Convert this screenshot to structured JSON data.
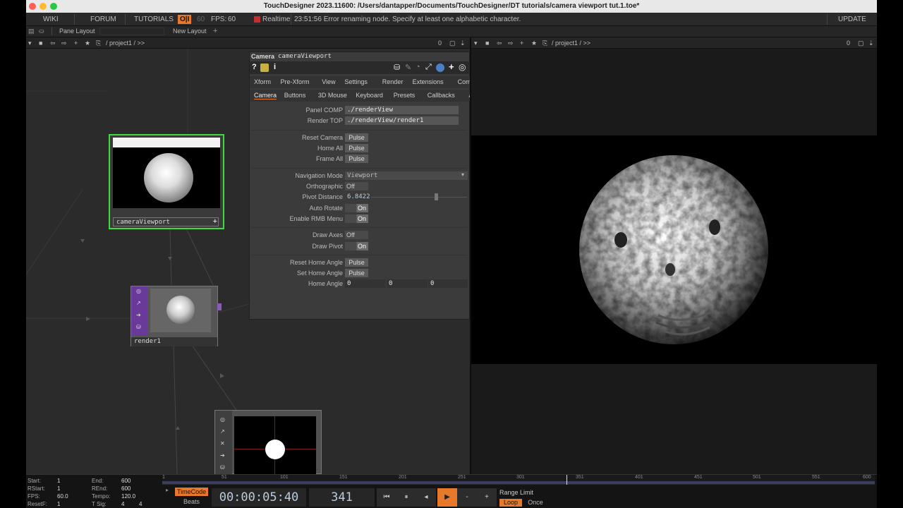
{
  "window": {
    "title": "TouchDesigner 2023.11600: /Users/dantapper/Documents/TouchDesigner/DT tutorials/camera viewport tut.1.toe*"
  },
  "menu": {
    "wiki": "WIKI",
    "forum": "FORUM",
    "tutorials": "TUTORIALS",
    "oi": "O|I",
    "sixty": "60",
    "fps_label": "FPS:",
    "fps_value": "60",
    "realtime": "Realtime",
    "message": "23:51:56 Error renaming node.  Specify at least one alphabetic character.",
    "update": "UPDATE"
  },
  "panebar": {
    "pane_layout": "Pane Layout",
    "new_layout": "New Layout",
    "plus": "+"
  },
  "left_path": {
    "path": "/ project1 / >>",
    "count": "0"
  },
  "right_path": {
    "path": "/ project1 / >>",
    "count": "0"
  },
  "nodes": {
    "camera": "cameraViewport",
    "render": "render1"
  },
  "panel": {
    "op_type": "Camera",
    "op_name": "cameraViewport",
    "tabs1": [
      "Xform",
      "Pre-Xform",
      "View",
      "Settings",
      "Render",
      "Extensions",
      "Common"
    ],
    "tabs2": [
      "Camera",
      "Buttons",
      "3D Mouse",
      "Keyboard",
      "Presets",
      "Callbacks",
      "About",
      "»"
    ],
    "panel_comp_label": "Panel COMP",
    "panel_comp_value": "./renderView",
    "render_top_label": "Render TOP",
    "render_top_value": "./renderView/render1",
    "reset_camera": "Reset Camera",
    "home_all": "Home All",
    "frame_all": "Frame All",
    "pulse": "Pulse",
    "nav_mode_label": "Navigation Mode",
    "nav_mode_value": "Viewport",
    "ortho_label": "Orthographic",
    "off": "Off",
    "on": "On",
    "pivot_dist_label": "Pivot Distance",
    "pivot_dist_value": "6.8422",
    "auto_rotate": "Auto Rotate",
    "enable_rmb": "Enable RMB Menu",
    "draw_axes": "Draw Axes",
    "draw_pivot": "Draw Pivot",
    "reset_home": "Reset Home Angle",
    "set_home": "Set Home Angle",
    "home_angle": "Home Angle",
    "home_angle_values": [
      "0",
      "0",
      "0"
    ]
  },
  "timeline": {
    "start_label": "Start:",
    "start": "1",
    "end_label": "End:",
    "end": "600",
    "rstart_label": "RStart:",
    "rstart": "1",
    "rend_label": "REnd:",
    "rend": "600",
    "fps_label": "FPS:",
    "fps": "60.0",
    "tempo_label": "Tempo:",
    "tempo": "120.0",
    "resetf_label": "ResetF:",
    "resetf": "1",
    "tsig_label": "T Sig:",
    "tsig_a": "4",
    "tsig_b": "4",
    "ruler": [
      "1",
      "51",
      "101",
      "151",
      "201",
      "251",
      "301",
      "351",
      "401",
      "451",
      "501",
      "551",
      "600"
    ],
    "timecode_label": "TimeCode",
    "beats_label": "Beats",
    "timecode": "00:00:05:40",
    "frame": "341",
    "range_limit": "Range Limit",
    "loop": "Loop",
    "once": "Once"
  },
  "colors": {
    "accent_orange": "#e8782a",
    "select_green": "#3cdc3c",
    "bg": "#2b2b2b"
  }
}
